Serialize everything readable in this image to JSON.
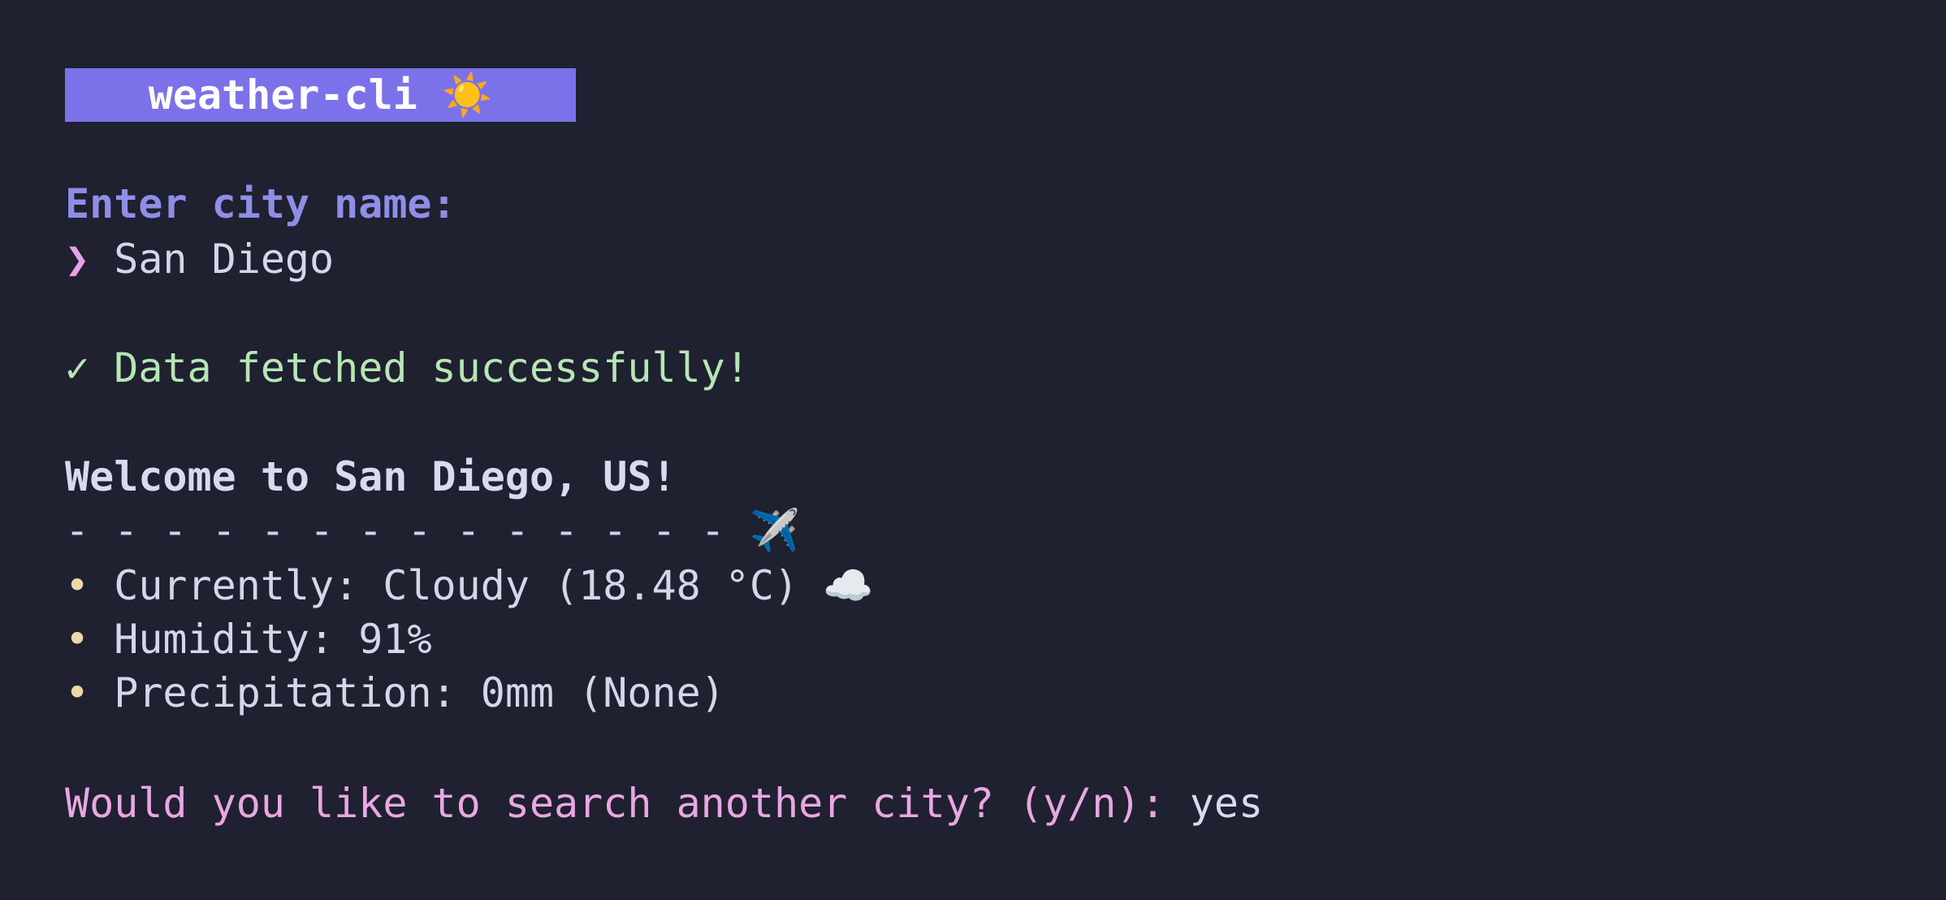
{
  "app": {
    "title": "weather-cli",
    "title_icon": "☀️"
  },
  "prompt": {
    "label": "Enter city name:",
    "chevron": "❯",
    "input_value": "San Diego"
  },
  "status": {
    "icon": "✓",
    "message": "Data fetched successfully!"
  },
  "report": {
    "heading": "Welcome to San Diego, US!",
    "divider": "- - - - - - - - - - - - - -",
    "divider_icon": "✈️",
    "bullet": "•",
    "items": [
      {
        "text": "Currently: Cloudy (18.48 °C)",
        "icon": "☁️"
      },
      {
        "text": "Humidity: 91%"
      },
      {
        "text": "Precipitation: 0mm (None)"
      }
    ]
  },
  "followup": {
    "question": "Would you like to search another city? (y/n):",
    "answer": "yes"
  },
  "colors": {
    "background": "#1f2030",
    "badge": "#7b72e9",
    "prompt_label": "#8f8ee6",
    "success": "#b6e6b4",
    "question": "#e8a7e2",
    "bullet": "#ecd9a6"
  }
}
